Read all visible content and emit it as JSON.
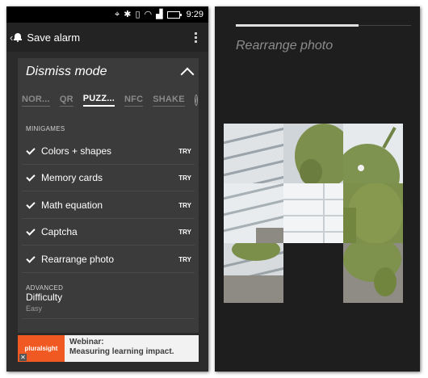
{
  "left_screen": {
    "status_bar": {
      "time": "9:29",
      "icons": [
        "crosshair-icon",
        "bluetooth-icon",
        "vibrate-icon",
        "wifi-icon",
        "signal-icon",
        "battery-icon"
      ]
    },
    "action_bar": {
      "title": "Save alarm"
    },
    "dismiss_card": {
      "title": "Dismiss mode",
      "tabs": [
        "NOR...",
        "QR",
        "PUZZ...",
        "NFC",
        "SHAKE"
      ],
      "active_tab": "PUZZ...",
      "minigames_label": "MINIGAMES",
      "minigames": [
        {
          "label": "Colors + shapes",
          "action": "TRY",
          "checked": true
        },
        {
          "label": "Memory cards",
          "action": "TRY",
          "checked": true
        },
        {
          "label": "Math equation",
          "action": "TRY",
          "checked": true
        },
        {
          "label": "Captcha",
          "action": "TRY",
          "checked": true
        },
        {
          "label": "Rearrange photo",
          "action": "TRY",
          "checked": true
        }
      ],
      "advanced_label": "ADVANCED",
      "difficulty": {
        "title": "Difficulty",
        "value": "Easy"
      }
    },
    "ad": {
      "logo": "pluralsight",
      "close": "✕",
      "line1": "Webinar:",
      "line2": "Measuring learning impact."
    }
  },
  "right_screen": {
    "title": "Rearrange photo",
    "progress": 0.7
  },
  "colors": {
    "ad_brand": "#f05a22",
    "card_bg": "#3b3b3b",
    "screen_bg": "#2b2b2b"
  }
}
